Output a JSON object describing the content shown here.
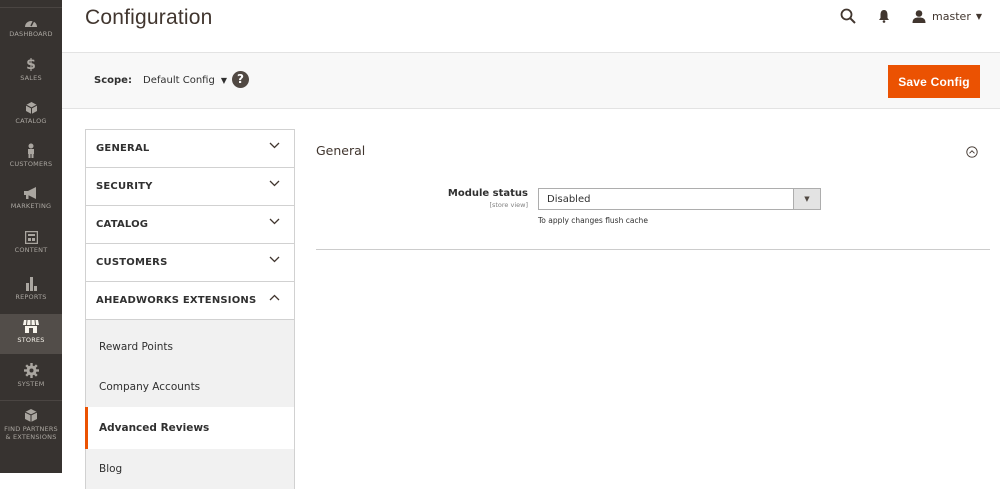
{
  "nav": {
    "items": [
      {
        "label": "DASHBOARD",
        "icon": "dashboard-icon"
      },
      {
        "label": "SALES",
        "icon": "dollar-icon"
      },
      {
        "label": "CATALOG",
        "icon": "cube-icon"
      },
      {
        "label": "CUSTOMERS",
        "icon": "person-icon"
      },
      {
        "label": "MARKETING",
        "icon": "megaphone-icon"
      },
      {
        "label": "CONTENT",
        "icon": "layout-icon"
      },
      {
        "label": "REPORTS",
        "icon": "bar-chart-icon"
      },
      {
        "label": "STORES",
        "icon": "store-icon"
      },
      {
        "label": "SYSTEM",
        "icon": "gear-icon"
      },
      {
        "label": "FIND PARTNERS",
        "label2": "& EXTENSIONS",
        "icon": "box-icon"
      }
    ],
    "active": "STORES"
  },
  "header": {
    "title": "Configuration",
    "user": "master"
  },
  "scope": {
    "label": "Scope:",
    "value": "Default Config"
  },
  "save_label": "Save Config",
  "tabs": [
    {
      "label": "GENERAL",
      "expanded": false
    },
    {
      "label": "SECURITY",
      "expanded": false
    },
    {
      "label": "CATALOG",
      "expanded": false
    },
    {
      "label": "CUSTOMERS",
      "expanded": false
    },
    {
      "label": "AHEADWORKS EXTENSIONS",
      "expanded": true
    }
  ],
  "subtabs": [
    {
      "label": "Reward Points"
    },
    {
      "label": "Company Accounts"
    },
    {
      "label": "Advanced Reviews"
    },
    {
      "label": "Blog"
    }
  ],
  "active_subtab": "Advanced Reviews",
  "section": {
    "title": "General",
    "field_label": "Module status",
    "field_scope": "[store view]",
    "field_value": "Disabled",
    "note": "To apply changes flush cache"
  },
  "colors": {
    "accent": "#eb5202",
    "nav_bg": "#373330",
    "nav_active": "#524d49"
  }
}
